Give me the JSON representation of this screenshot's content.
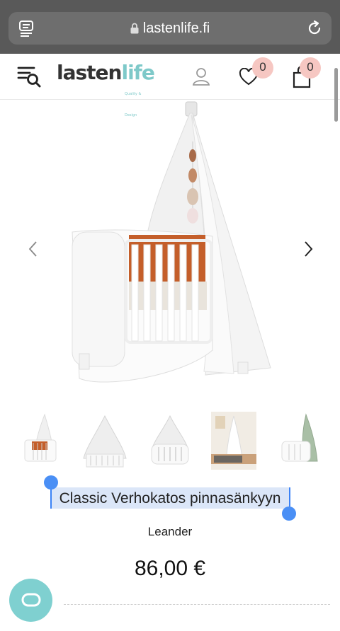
{
  "browser": {
    "url": "lastenlife.fi",
    "icons": [
      "reader-icon",
      "lock-icon",
      "reload-icon"
    ]
  },
  "header": {
    "logo_part1": "lasten",
    "logo_part2": "life",
    "logo_tagline": "Quality & Design",
    "wishlist_count": "0",
    "cart_count": "0",
    "icons": [
      "menu-search-icon",
      "user-icon",
      "heart-icon",
      "shopping-bag-icon"
    ]
  },
  "colors": {
    "accent": "#7ec9c9",
    "badge": "#f6c7c2",
    "selection": "#dbe6f8",
    "selection_handle": "#4a8ff5"
  },
  "gallery": {
    "thumbnail_count": 5,
    "icons": [
      "chevron-left-icon",
      "chevron-right-icon"
    ]
  },
  "product": {
    "title": "Classic Verhokatos pinnasänkyyn",
    "brand": "Leander",
    "price": "86,00 €"
  },
  "chat": {
    "icon": "chat-icon"
  }
}
